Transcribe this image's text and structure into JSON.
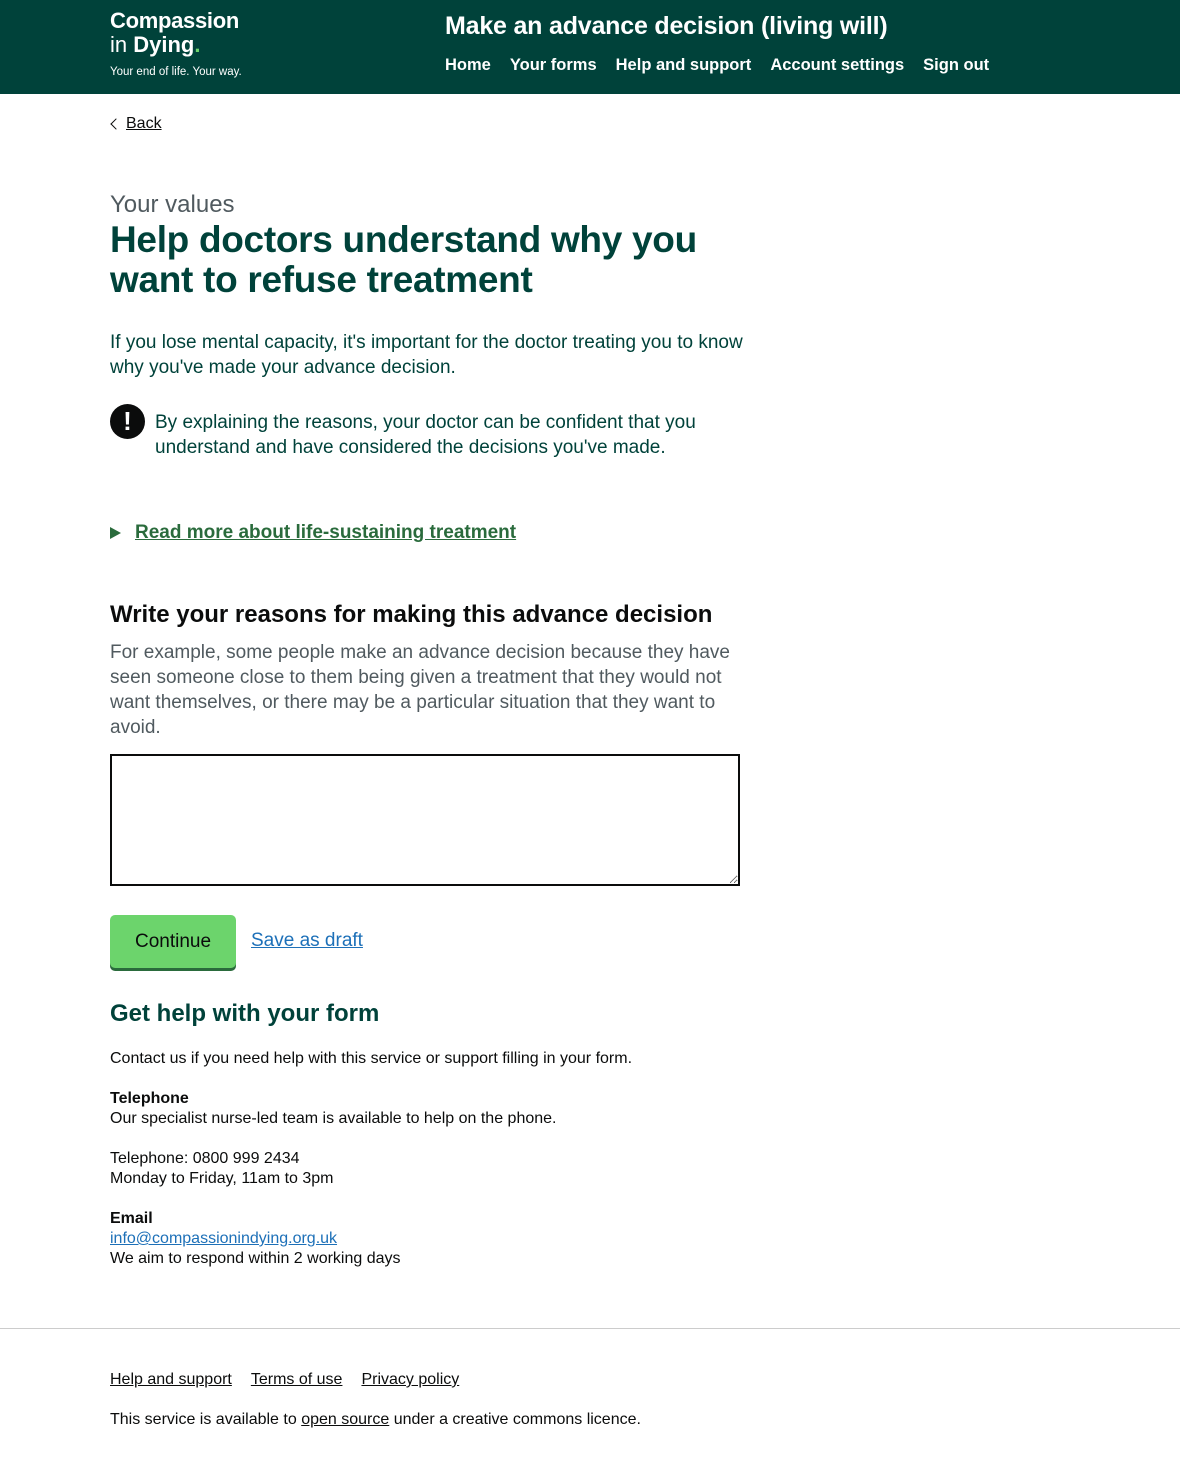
{
  "header": {
    "logo": {
      "line1": "Compassion",
      "line2_prefix": "in",
      "line2_word": "Dying",
      "line2_dot": ".",
      "tagline": "Your end of life. Your way."
    },
    "service_title": "Make an advance decision (living will)",
    "nav": [
      "Home",
      "Your forms",
      "Help and support",
      "Account settings",
      "Sign out"
    ]
  },
  "back_label": "Back",
  "page": {
    "caption": "Your values",
    "title": "Help doctors understand why you want to refuse treatment",
    "lead": "If you lose mental capacity, it's important for the doctor treating you to know why you've made your advance decision.",
    "warning_icon": "!",
    "warning_text": "By explaining the reasons, your doctor can be confident that you understand and have considered the decisions you've made.",
    "details_summary": "Read more about life-sustaining treatment"
  },
  "form": {
    "label": "Write your reasons for making this advance decision",
    "hint": "For example, some people make an advance decision because they have seen someone close to them being given a treatment that they would not want themselves, or there may be a particular situation that they want to avoid.",
    "textarea_value": "",
    "continue_label": "Continue",
    "save_draft_label": "Save as draft"
  },
  "help": {
    "title": "Get help with your form",
    "intro": "Contact us if you need help with this service or support filling in your form.",
    "telephone_heading": "Telephone",
    "telephone_desc": "Our specialist nurse-led team is available to help on the phone.",
    "telephone_number": "Telephone: 0800 999 2434",
    "telephone_hours": "Monday to Friday, 11am to 3pm",
    "email_heading": "Email",
    "email_address": "info@compassionindying.org.uk",
    "email_response": "We aim to respond within 2 working days"
  },
  "footer": {
    "links": [
      "Help and support",
      "Terms of use",
      "Privacy policy"
    ],
    "licence_prefix": "This service is available to",
    "licence_link": "open source",
    "licence_suffix": "under a creative commons licence."
  },
  "colors": {
    "header_bg": "#00423a",
    "brand_green": "#6cd46c",
    "heading_green": "#00423a",
    "link_green": "#2a6b3c",
    "link_blue": "#1d70b8"
  }
}
